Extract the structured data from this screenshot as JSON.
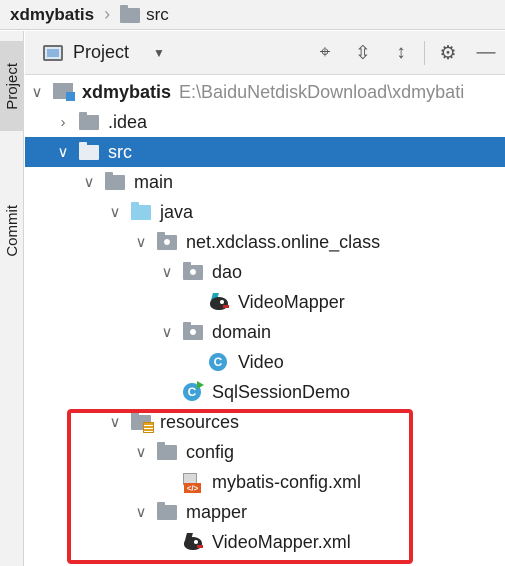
{
  "breadcrumb": {
    "root": "xdmybatis",
    "child": "src"
  },
  "toolstrip": {
    "project_tab": "Project",
    "commit_tab": "Commit"
  },
  "header": {
    "view_label": "Project",
    "icons": [
      "locate-icon",
      "expand-all-icon",
      "collapse-all-icon",
      "gear-icon",
      "minimize-icon"
    ]
  },
  "tree": {
    "project": {
      "name": "xdmybatis",
      "path": "E:\\BaiduNetdiskDownload\\xdmybati"
    },
    "idea": ".idea",
    "src": "src",
    "main": "main",
    "java": "java",
    "package": "net.xdclass.online_class",
    "dao": "dao",
    "video_mapper": "VideoMapper",
    "domain": "domain",
    "video": "Video",
    "sql_session_demo": "SqlSessionDemo",
    "resources": "resources",
    "config": "config",
    "mybatis_config": "mybatis-config.xml",
    "mapper": "mapper",
    "video_mapper_xml": "VideoMapper.xml"
  },
  "colors": {
    "selection": "#2675bf",
    "highlight_border": "#e8262b"
  }
}
